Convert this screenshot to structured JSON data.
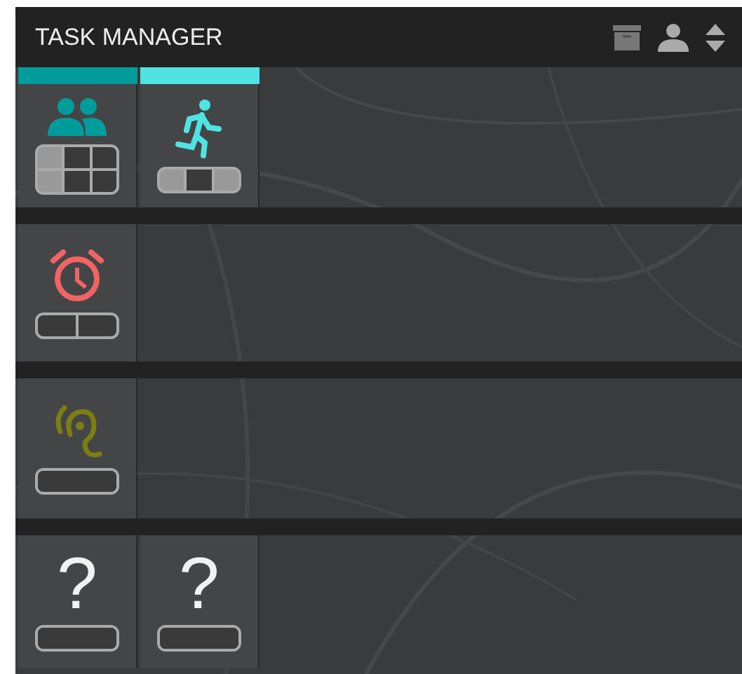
{
  "header": {
    "title": "TASK MANAGER"
  },
  "rows": [
    {
      "top_bar": true,
      "tiles": [
        {
          "kind": "people",
          "color": "#009c9c",
          "slots": [
            [
              {
                "filled": true
              },
              {
                "filled": false
              },
              {
                "filled": false
              }
            ],
            [
              {
                "filled": true
              },
              {
                "filled": false
              },
              {
                "filled": false
              }
            ]
          ]
        },
        {
          "kind": "runner",
          "color": "#4fe3e3",
          "slots": [
            [
              {
                "filled": true
              },
              {
                "filled": false
              },
              {
                "filled": true
              }
            ]
          ]
        }
      ]
    },
    {
      "top_bar": false,
      "tiles": [
        {
          "kind": "alarm",
          "color": "#f26363",
          "slots": [
            [
              {
                "filled": false
              },
              {
                "filled": false
              }
            ]
          ]
        }
      ]
    },
    {
      "top_bar": false,
      "tiles": [
        {
          "kind": "ear",
          "color": "#7d7d12",
          "slots": [
            [
              {
                "filled": false
              }
            ]
          ]
        }
      ]
    },
    {
      "top_bar": false,
      "tiles": [
        {
          "kind": "unknown",
          "label": "?",
          "color": "#f2f2f2",
          "slots": [
            [
              {
                "filled": false
              }
            ]
          ]
        },
        {
          "kind": "unknown",
          "label": "?",
          "color": "#f2f2f2",
          "slots": [
            [
              {
                "filled": false
              }
            ]
          ]
        }
      ]
    }
  ]
}
